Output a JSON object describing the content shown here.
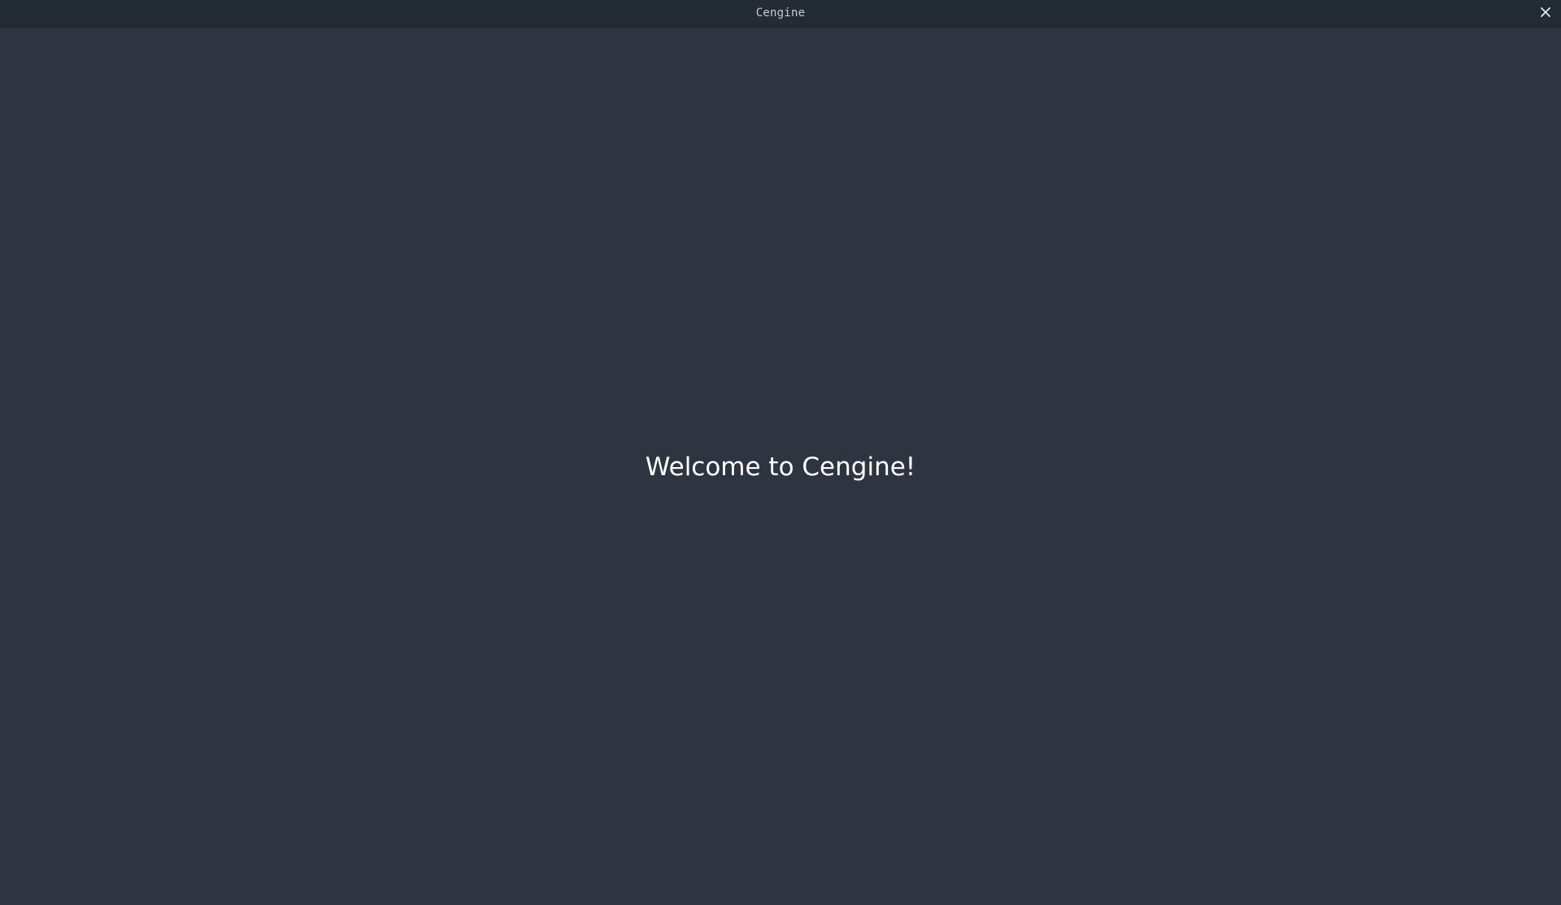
{
  "window": {
    "title": "Cengine",
    "close_icon": "close-icon"
  },
  "main": {
    "welcome_text": "Welcome to Cengine!"
  },
  "colors": {
    "background": "#2e3440",
    "titlebar": "#232b33",
    "text": "#ffffff"
  }
}
